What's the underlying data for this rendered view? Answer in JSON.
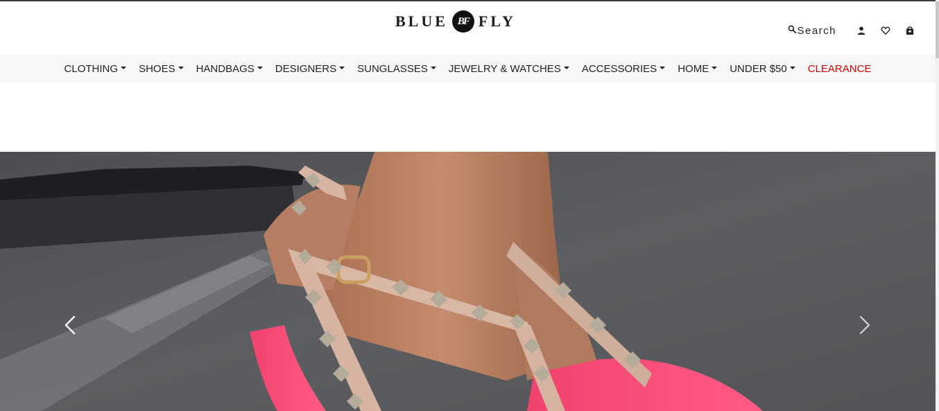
{
  "brand": {
    "logo_left": "BLUE",
    "logo_mark": "BF",
    "logo_right": "FLY"
  },
  "header": {
    "search_label": "Search",
    "icons": [
      "search-icon",
      "account-icon",
      "wishlist-heart-icon",
      "shopping-bag-icon"
    ]
  },
  "nav": {
    "items": [
      {
        "label": "CLOTHING",
        "dropdown": true
      },
      {
        "label": "SHOES",
        "dropdown": true
      },
      {
        "label": "HANDBAGS",
        "dropdown": true
      },
      {
        "label": "DESIGNERS",
        "dropdown": true
      },
      {
        "label": "SUNGLASSES",
        "dropdown": true
      },
      {
        "label": "JEWELRY & WATCHES",
        "dropdown": true
      },
      {
        "label": "ACCESSORIES",
        "dropdown": true
      },
      {
        "label": "HOME",
        "dropdown": true
      },
      {
        "label": "UNDER $50",
        "dropdown": true
      },
      {
        "label": "CLEARANCE",
        "dropdown": false
      }
    ],
    "clearance_color": "#e00000"
  },
  "hero": {
    "image_subject": "studded-strappy-heels-photo",
    "prev_icon": "chevron-left-icon",
    "next_icon": "chevron-right-icon"
  },
  "colors": {
    "nav_background": "#f6f7f9",
    "text": "#222222"
  }
}
